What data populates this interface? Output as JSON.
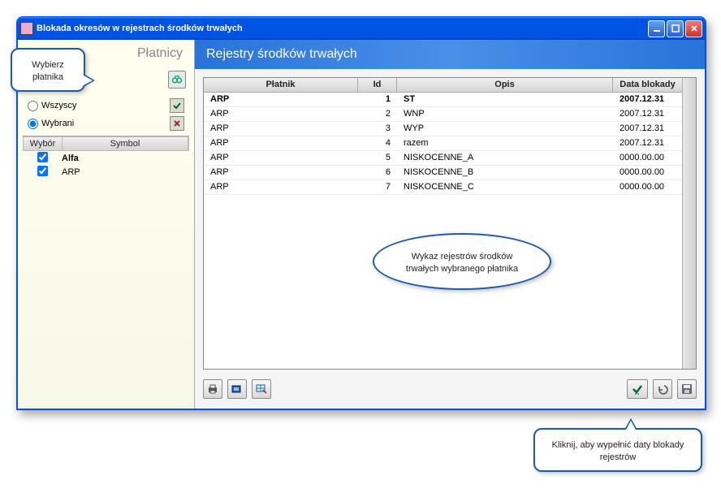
{
  "titlebar": {
    "title": "Blokada okresów w rejestrach środków trwałych"
  },
  "sidebar": {
    "header": "Płatnicy",
    "filter": {
      "all_label": "Wszyscy",
      "selected_label": "Wybrani",
      "selected_option": "Wybrani"
    },
    "columns": {
      "wybor": "Wybór",
      "symbol": "Symbol"
    },
    "rows": [
      {
        "checked": true,
        "symbol": "Alfa",
        "bold": true
      },
      {
        "checked": true,
        "symbol": "ARP",
        "bold": false
      }
    ]
  },
  "main": {
    "header": "Rejestry środków trwałych"
  },
  "registers": {
    "columns": {
      "platnik": "Płatnik",
      "id": "Id",
      "opis": "Opis",
      "data": "Data blokady"
    },
    "rows": [
      {
        "platnik": "ARP",
        "id": "1",
        "opis": "ST",
        "data": "2007.12.31",
        "selected": true
      },
      {
        "platnik": "ARP",
        "id": "2",
        "opis": "WNP",
        "data": "2007.12.31",
        "selected": false
      },
      {
        "platnik": "ARP",
        "id": "3",
        "opis": "WYP",
        "data": "2007.12.31",
        "selected": false
      },
      {
        "platnik": "ARP",
        "id": "4",
        "opis": "razem",
        "data": "2007.12.31",
        "selected": false
      },
      {
        "platnik": "ARP",
        "id": "5",
        "opis": "NISKOCENNE_A",
        "data": "0000.00.00",
        "selected": false
      },
      {
        "platnik": "ARP",
        "id": "6",
        "opis": "NISKOCENNE_B",
        "data": "0000.00.00",
        "selected": false
      },
      {
        "platnik": "ARP",
        "id": "7",
        "opis": "NISKOCENNE_C",
        "data": "0000.00.00",
        "selected": false
      }
    ]
  },
  "callouts": {
    "choose_payer": "Wybierz płatnika",
    "registers_list": "Wykaz rejestrów środków trwałych wybranego płatnika",
    "click_fill": "Kliknij, aby wypełnić daty blokady rejestrów"
  }
}
